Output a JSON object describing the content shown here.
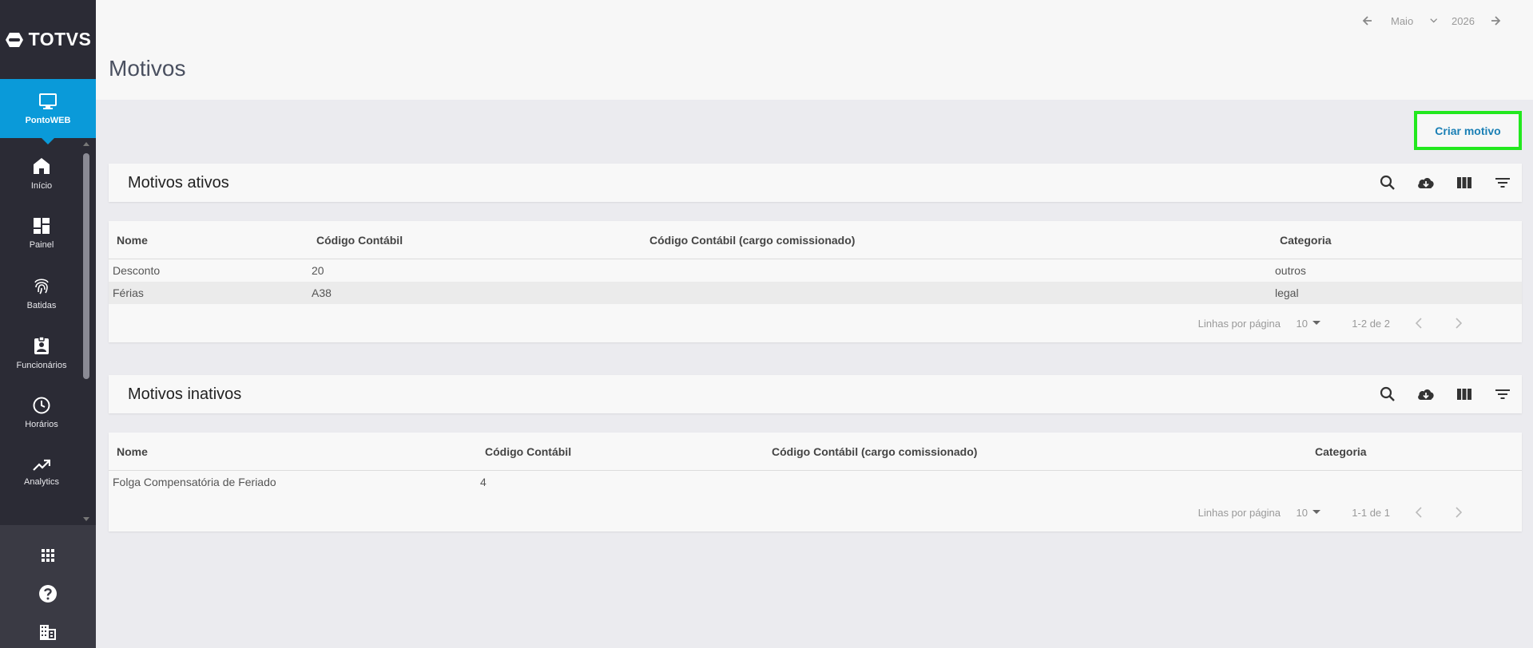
{
  "brand": {
    "name": "TOTVS",
    "accent": "#0a9ad9",
    "highlight": "#22e81e"
  },
  "app": {
    "label": "PontoWEB",
    "icon": "monitor-icon"
  },
  "sidebar": {
    "items": [
      {
        "label": "Início",
        "icon": "home-icon"
      },
      {
        "label": "Painel",
        "icon": "dashboard-icon"
      },
      {
        "label": "Batidas",
        "icon": "fingerprint-icon"
      },
      {
        "label": "Funcionários",
        "icon": "badge-icon"
      },
      {
        "label": "Horários",
        "icon": "clock-icon"
      },
      {
        "label": "Analytics",
        "icon": "trending-icon"
      }
    ],
    "bottom_icons": [
      "apps-grid-icon",
      "help-icon",
      "company-icon"
    ]
  },
  "header": {
    "title": "Motivos",
    "period": {
      "month": "Maio",
      "year": "2026"
    }
  },
  "actions": {
    "create_label": "Criar motivo"
  },
  "active": {
    "title": "Motivos ativos",
    "columns": [
      "Nome",
      "Código Contábil",
      "Código Contábil (cargo comissionado)",
      "Categoria"
    ],
    "rows": [
      {
        "nome": "Desconto",
        "codigo": "20",
        "codigo_cargo": "",
        "categoria": "outros"
      },
      {
        "nome": "Férias",
        "codigo": "A38",
        "codigo_cargo": "",
        "categoria": "legal"
      }
    ],
    "footer": {
      "rows_per_page_label": "Linhas por página",
      "rows_per_page": "10",
      "range": "1-2 de 2"
    }
  },
  "inactive": {
    "title": "Motivos inativos",
    "columns": [
      "Nome",
      "Código Contábil",
      "Código Contábil (cargo comissionado)",
      "Categoria"
    ],
    "rows": [
      {
        "nome": "Folga Compensatória de Feriado",
        "codigo": "4",
        "codigo_cargo": "",
        "categoria": ""
      }
    ],
    "footer": {
      "rows_per_page_label": "Linhas por página",
      "rows_per_page": "10",
      "range": "1-1 de 1"
    }
  }
}
